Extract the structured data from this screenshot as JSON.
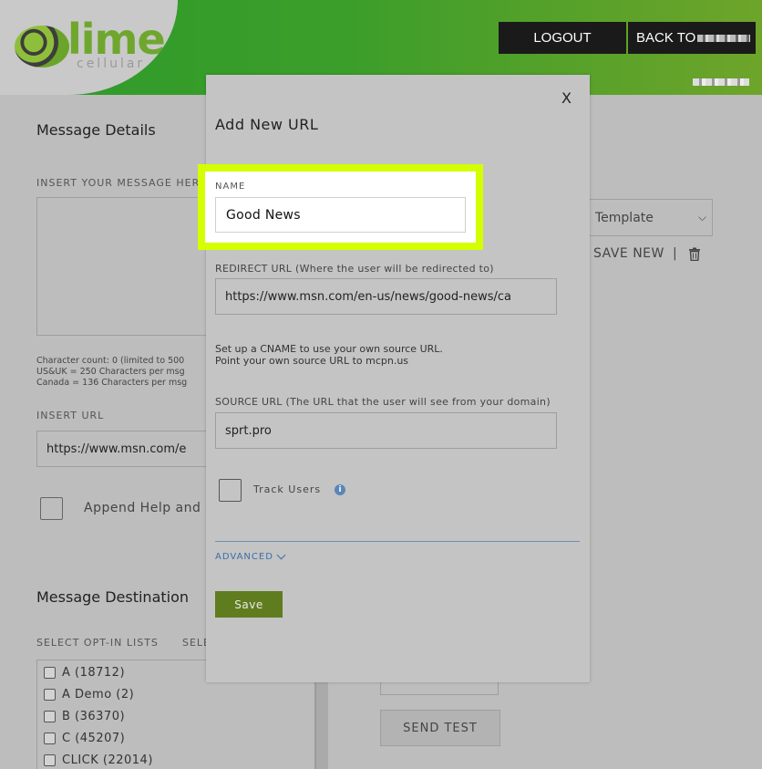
{
  "header": {
    "logo_text": "lime",
    "logo_sub": "cellular",
    "logout_label": "LOGOUT",
    "back_label": "BACK TO"
  },
  "background": {
    "message_details_title": "Message Details",
    "insert_message_label": "INSERT YOUR MESSAGE HERE",
    "char_count_lines": [
      "Character count: 0 (limited to 500",
      "US&UK = 250 Characters per msg",
      "Canada = 136 Characters per msg"
    ],
    "insert_url_label": "INSERT URL",
    "insert_url_value": "https://www.msn.com/e",
    "append_label": "Append Help and",
    "template_select_value": "Template",
    "save_new_label": "SAVE NEW",
    "separator": "|",
    "message_destination_title": "Message Destination",
    "select_optin_label": "SELECT OPT-IN LISTS",
    "select_other_label": "SELE",
    "lists": [
      "A (18712)",
      "A Demo (2)",
      "B (36370)",
      "C (45207)",
      "CLICK (22014)"
    ],
    "send_test_label": "SEND TEST"
  },
  "modal": {
    "close_label": "X",
    "title": "Add New URL",
    "name_label": "NAME",
    "name_value": "Good News",
    "redirect_label": "REDIRECT URL (Where the user will be redirected to)",
    "redirect_value": "https://www.msn.com/en-us/news/good-news/ca",
    "help_line1": "Set up a CNAME to use your own source URL.",
    "help_line2": "Point your own source URL to mcpn.us",
    "source_label": "SOURCE URL (The URL that the user will see from your domain)",
    "source_value": "sprt.pro",
    "track_users_label": "Track Users",
    "info_glyph": "i",
    "advanced_label": "ADVANCED",
    "save_label": "Save"
  },
  "colors": {
    "highlight": "#d4ff00",
    "save_button": "#5f7d1f",
    "header_green": "#3b9e2a"
  }
}
